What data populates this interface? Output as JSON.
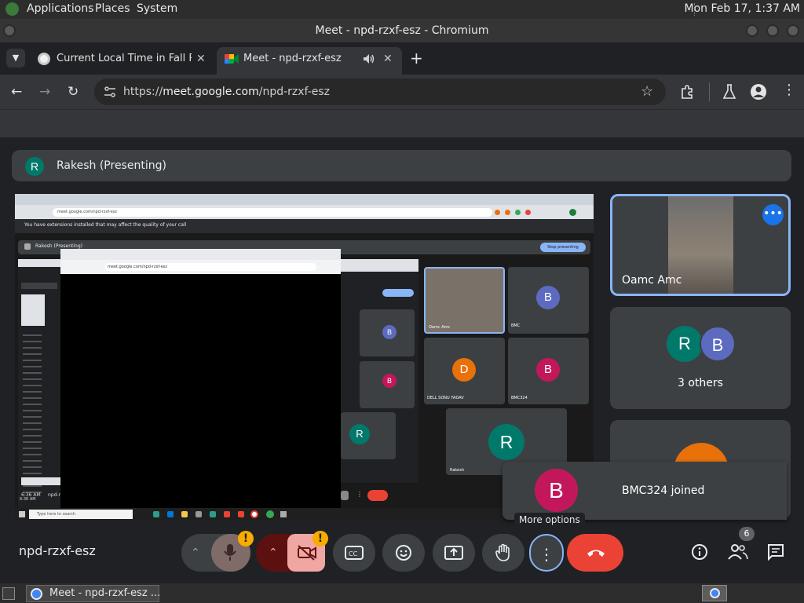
{
  "system_bar": {
    "menus": [
      "Applications",
      "Places",
      "System"
    ],
    "clock": "Mon Feb 17,  1:37 AM"
  },
  "window": {
    "title": "Meet - npd-rzxf-esz - Chromium"
  },
  "tabs": [
    {
      "title": "Current Local Time in Fall Riv",
      "active": false
    },
    {
      "title": "Meet - npd-rzxf-esz",
      "active": true
    }
  ],
  "address_bar": {
    "scheme": "https://",
    "host": "meet.google.com",
    "path": "/npd-rzxf-esz"
  },
  "presenting_banner": {
    "avatar_letter": "R",
    "text": "Rakesh (Presenting)"
  },
  "shared_screen": {
    "warning_text": "You have extensions installed that may affect the quality of your call",
    "presenter": "Rakesh (Presenting)",
    "stop_presenting": "Stop presenting",
    "inner_url": "meet.google.com/npd-rzxf-esz",
    "inner_tiles": [
      {
        "name": "Oamc Amc",
        "letter": ""
      },
      {
        "name": "BMC",
        "letter": "B"
      },
      {
        "name": "DELL SONU YADAV",
        "letter": "D"
      },
      {
        "name": "BMC324",
        "letter": "B"
      },
      {
        "name": "Rakesh",
        "letter": "R"
      }
    ],
    "taskbar_time": "6:36 AM",
    "taskbar_search": "Type here to search",
    "meeting_code_small": "npd-r"
  },
  "tiles": {
    "top": {
      "name": "Oamc Amc"
    },
    "others": {
      "letters": [
        "R",
        "B"
      ],
      "label": "3 others"
    },
    "toast": {
      "letter": "B",
      "text": "BMC324 joined"
    }
  },
  "tooltip": "More options",
  "meeting_code": "npd-rzxf-esz",
  "people_count": "6",
  "taskbar": {
    "window_label": "Meet - npd-rzxf-esz ..."
  },
  "colors": {
    "accent_blue": "#8ab4f8",
    "leave_red": "#ea4335",
    "avatar_teal": "#00796b",
    "avatar_indigo": "#5c6bc0",
    "avatar_pink": "#c2185b",
    "avatar_orange": "#e8710a",
    "warning_yellow": "#f9ab00"
  }
}
